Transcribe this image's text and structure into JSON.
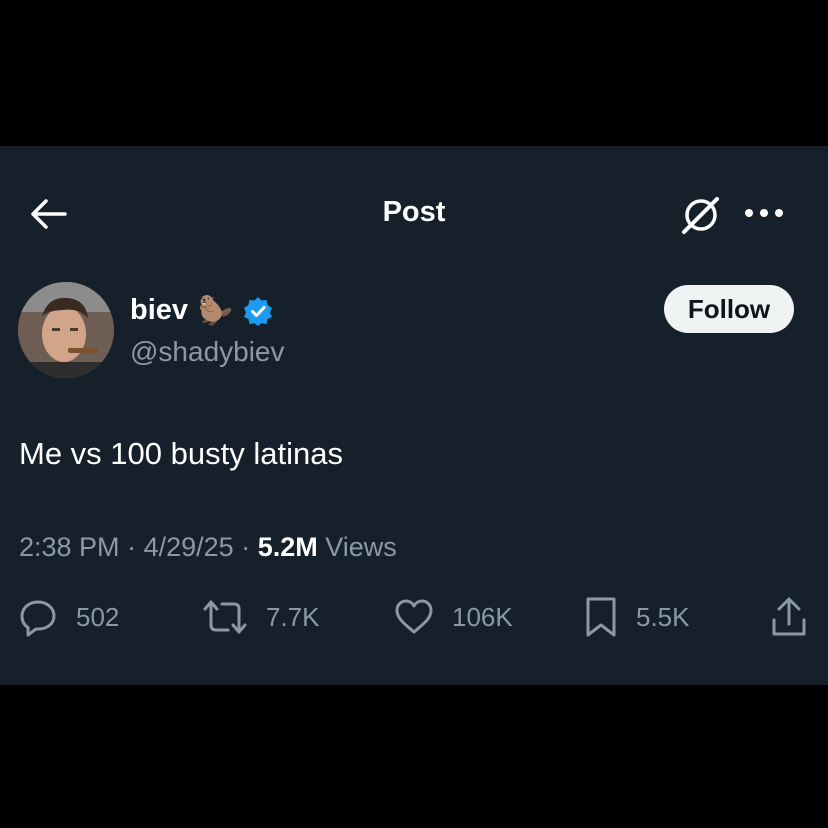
{
  "header": {
    "title": "Post",
    "icons": {
      "back": "arrow-left-icon",
      "grok": "grok-icon",
      "more": "more-horizontal-icon"
    }
  },
  "author": {
    "name": "biev",
    "emoji": "🦫",
    "handle": "@shadybiev",
    "verified": true,
    "follow_label": "Follow"
  },
  "post": {
    "text": "Me vs 100 busty latinas",
    "time": "2:38 PM",
    "date": "4/29/25",
    "separator": "·",
    "views_count": "5.2M",
    "views_label": "Views"
  },
  "actions": {
    "replies": "502",
    "reposts": "7.7K",
    "likes": "106K",
    "bookmarks": "5.5K"
  },
  "colors": {
    "background": "#15202b",
    "text": "#e7e9ea",
    "secondary": "#8b98a5",
    "verified": "#1d9bf0",
    "letterbox": "#000000"
  }
}
